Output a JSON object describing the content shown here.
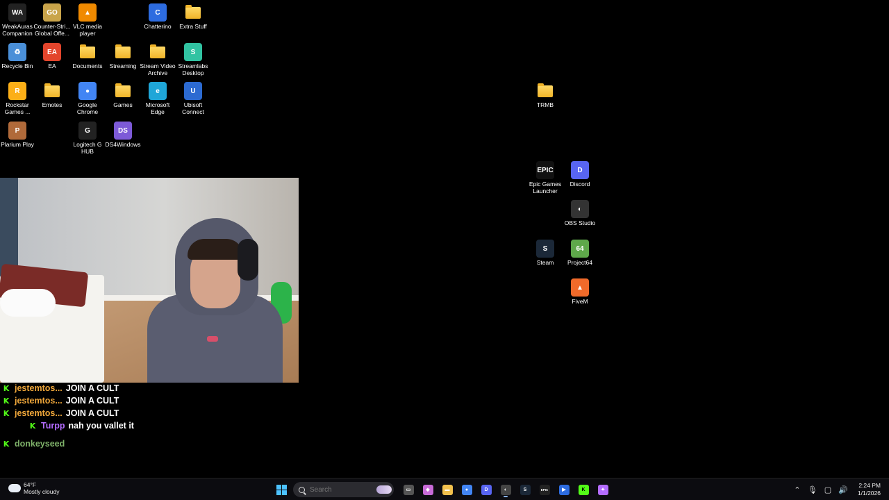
{
  "desktop": {
    "icons_left": [
      {
        "label": "WeakAuras Companion",
        "color": "#222",
        "glyph": "WA"
      },
      {
        "label": "Counter-Stri... Global Offe...",
        "color": "#c9a44a",
        "glyph": "GO"
      },
      {
        "label": "VLC media player",
        "color": "#f08a00",
        "glyph": "▲"
      },
      {
        "label": "Chatterino",
        "color": "#2d6ce0",
        "glyph": "C"
      },
      {
        "label": "Extra Stuff",
        "color": "folder",
        "glyph": ""
      },
      {
        "label": "Recycle Bin",
        "color": "#4a8fd8",
        "glyph": "♻"
      },
      {
        "label": "EA",
        "color": "#e3452c",
        "glyph": "EA"
      },
      {
        "label": "Documents",
        "color": "folder",
        "glyph": ""
      },
      {
        "label": "Streaming",
        "color": "folder",
        "glyph": ""
      },
      {
        "label": "Stream Video Archive",
        "color": "folder",
        "glyph": ""
      },
      {
        "label": "Streamlabs Desktop",
        "color": "#31c3a2",
        "glyph": "S"
      },
      {
        "label": "Rockstar Games ...",
        "color": "#fcaf17",
        "glyph": "R"
      },
      {
        "label": "Emotes",
        "color": "folder",
        "glyph": ""
      },
      {
        "label": "Google Chrome",
        "color": "#4285f4",
        "glyph": "●"
      },
      {
        "label": "Games",
        "color": "folder",
        "glyph": ""
      },
      {
        "label": "Microsoft Edge",
        "color": "#1fa6d8",
        "glyph": "e"
      },
      {
        "label": "Ubisoft Connect",
        "color": "#2c6ad1",
        "glyph": "U"
      },
      {
        "label": "Plarium Play",
        "color": "#b06a3a",
        "glyph": "P"
      },
      {
        "label": "Logitech G HUB",
        "color": "#222",
        "glyph": "G"
      },
      {
        "label": "DS4Windows",
        "color": "#7d5ad8",
        "glyph": "DS"
      }
    ],
    "icons_right": [
      {
        "label": "TRMB",
        "color": "folder",
        "glyph": ""
      },
      {
        "label": "Epic Games Launcher",
        "color": "#111",
        "glyph": "EPIC"
      },
      {
        "label": "Discord",
        "color": "#5865f2",
        "glyph": "D"
      },
      {
        "label": "OBS Studio",
        "color": "#333",
        "glyph": "◐"
      },
      {
        "label": "Steam",
        "color": "#1b2838",
        "glyph": "S"
      },
      {
        "label": "Project64",
        "color": "#5ea84a",
        "glyph": "64"
      },
      {
        "label": "FiveM",
        "color": "#f06a2a",
        "glyph": "▲"
      }
    ]
  },
  "chat": {
    "messages": [
      {
        "user": "jestemtos...",
        "user_color": "#f0a73a",
        "text": "JOIN A CULT",
        "indent": false
      },
      {
        "user": "jestemtos...",
        "user_color": "#f0a73a",
        "text": "JOIN A CULT",
        "indent": false
      },
      {
        "user": "jestemtos...",
        "user_color": "#f0a73a",
        "text": "JOIN A CULT",
        "indent": false
      },
      {
        "user": "Turpp",
        "user_color": "#b46cff",
        "text": "nah you vallet it",
        "indent": true
      },
      {
        "user": "donkeyseed",
        "user_color": "#7fb26a",
        "text": "",
        "indent": false
      }
    ]
  },
  "taskbar": {
    "weather": {
      "temp": "64°F",
      "condition": "Mostly cloudy"
    },
    "search_placeholder": "Search",
    "apps": [
      {
        "name": "task-view",
        "color": "#555",
        "glyph": "▭"
      },
      {
        "name": "copilot",
        "color": "#c86bd8",
        "glyph": "◆"
      },
      {
        "name": "file-explorer",
        "color": "#f2c14e",
        "glyph": "▬"
      },
      {
        "name": "chrome",
        "color": "#4285f4",
        "glyph": "●"
      },
      {
        "name": "discord",
        "color": "#5865f2",
        "glyph": "D"
      },
      {
        "name": "obs",
        "color": "#444",
        "glyph": "◐"
      },
      {
        "name": "steam",
        "color": "#1b2838",
        "glyph": "S"
      },
      {
        "name": "epic-games",
        "color": "#222",
        "glyph": "EPIC"
      },
      {
        "name": "streamlabs",
        "color": "#2d6ce0",
        "glyph": "▶"
      },
      {
        "name": "kick",
        "color": "#53fc18",
        "glyph": "K"
      },
      {
        "name": "chatterino",
        "color": "#b46cff",
        "glyph": "✦"
      }
    ],
    "tray": {
      "chevron": "⌃",
      "mic": "🎙",
      "network": "▢",
      "volume": "🔊"
    },
    "clock": {
      "time": "2:24 PM",
      "date": "1/1/2026"
    }
  }
}
